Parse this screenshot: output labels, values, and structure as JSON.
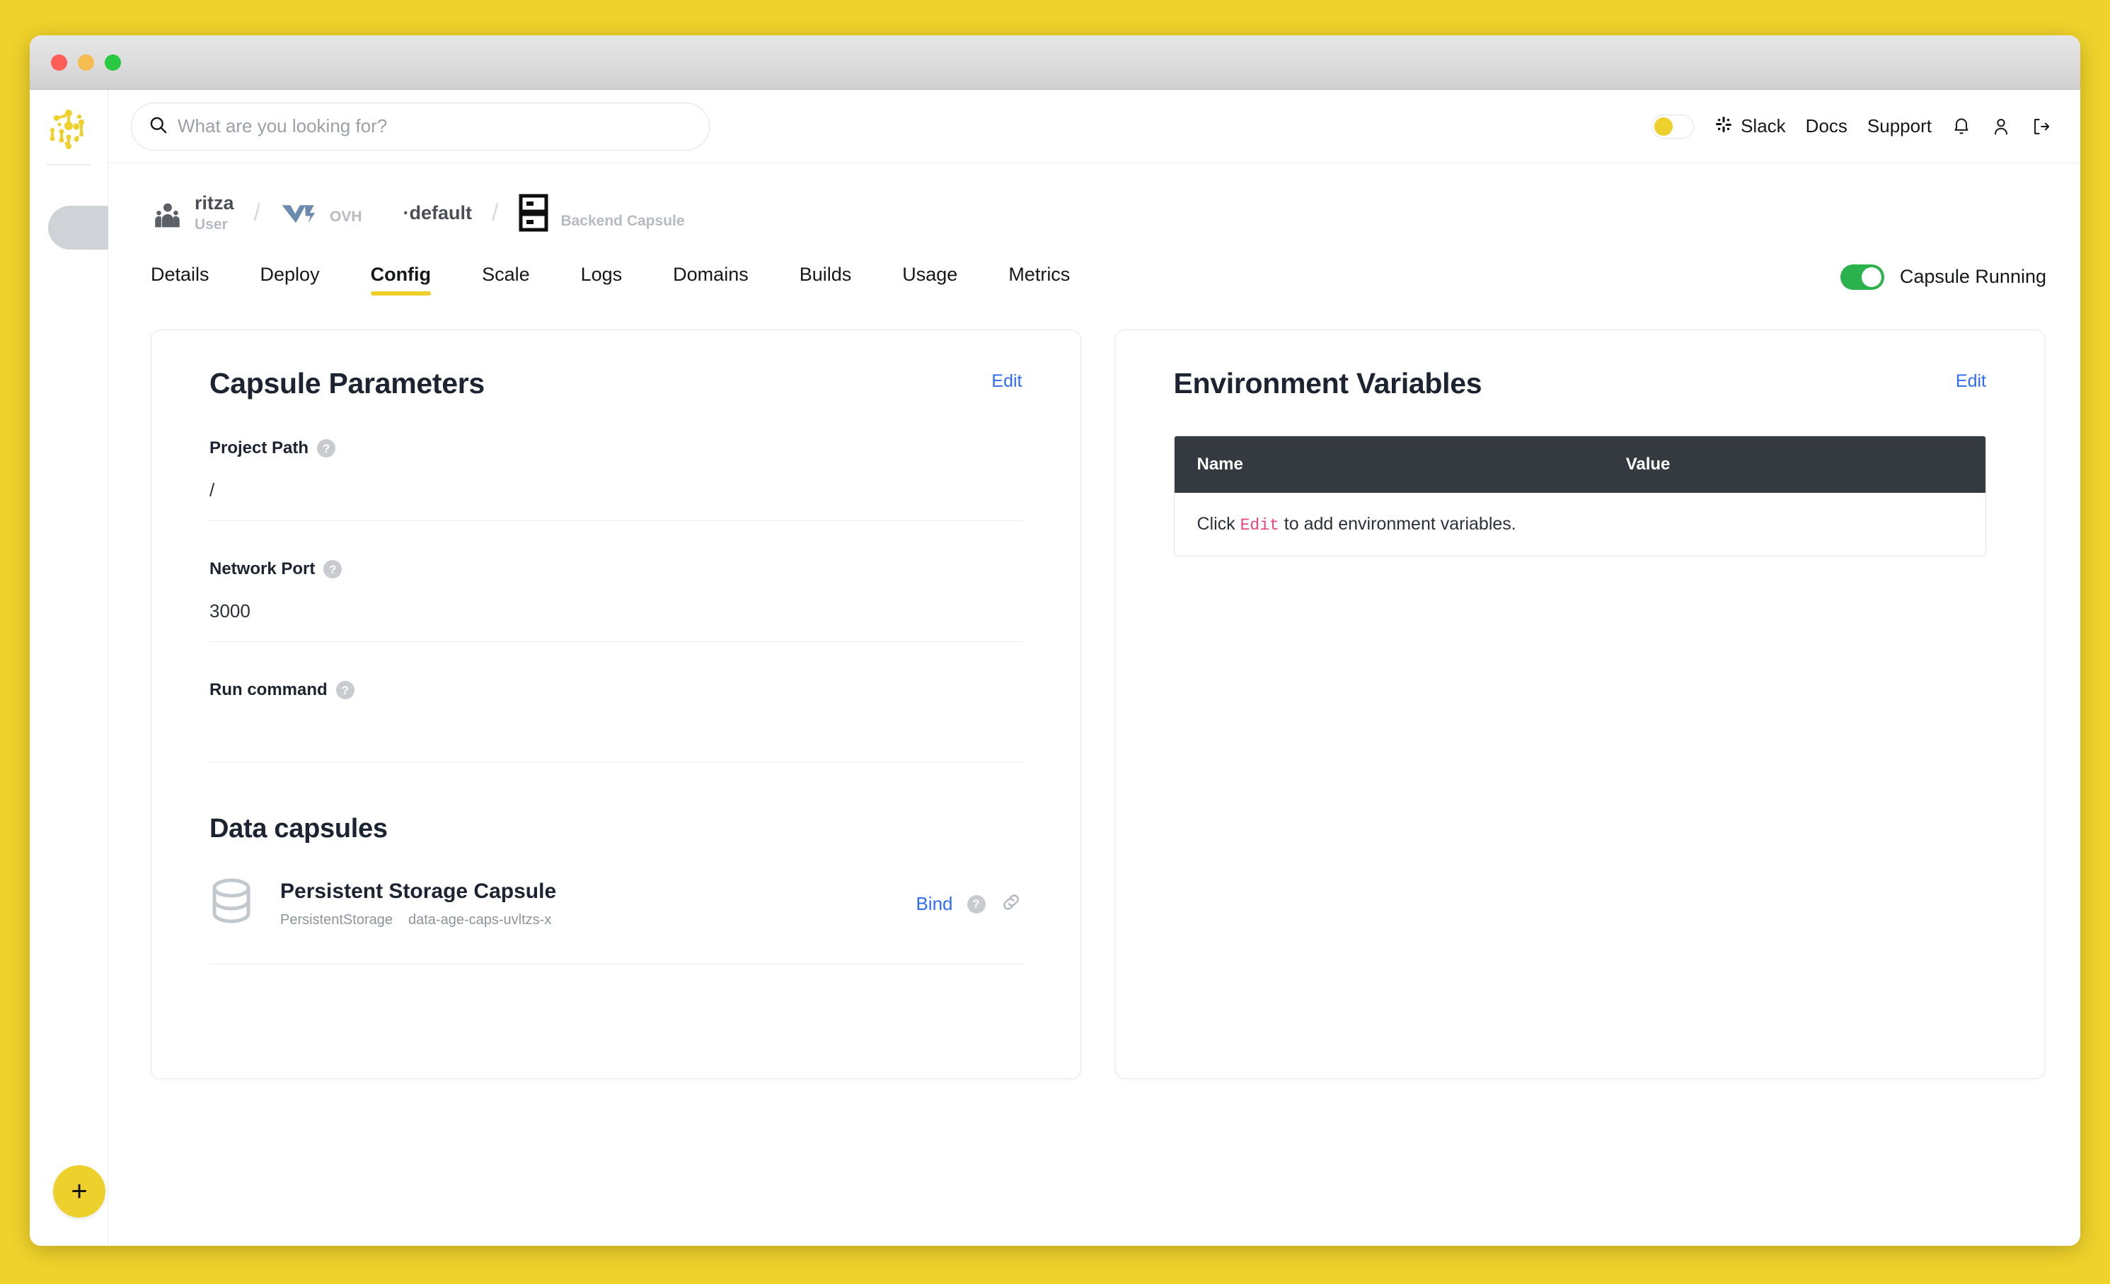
{
  "colors": {
    "page_background": "#EFD22B",
    "brand_yellow": "#EDD02B",
    "accent_link": "#2f6bff",
    "running_green": "#2bb24c",
    "table_header": "#343a40",
    "code_pink": "#e8467c"
  },
  "window": {
    "traffic_lights": [
      "close-red",
      "minimize-yellow",
      "zoom-green"
    ]
  },
  "rail": {
    "logo_name": "code-capsules-logo",
    "add_button_label": "+"
  },
  "topbar": {
    "search": {
      "placeholder": "What are you looking for?",
      "value": "",
      "icon": "search-icon"
    },
    "theme_toggle": {
      "state": "off",
      "icon": "theme-toggle"
    },
    "links": [
      {
        "label": "Slack",
        "icon": "slack-icon"
      },
      {
        "label": "Docs",
        "icon": null
      },
      {
        "label": "Support",
        "icon": null
      }
    ],
    "icons": [
      {
        "name": "notifications-bell-icon"
      },
      {
        "name": "user-account-icon"
      },
      {
        "name": "logout-icon"
      }
    ]
  },
  "breadcrumb": {
    "items": [
      {
        "title": "ritza",
        "subtitle": "User",
        "icon": "team-users-icon"
      },
      {
        "title": "",
        "subtitle": "OVH",
        "icon": "ovh-logo-icon"
      },
      {
        "title": "·default",
        "subtitle": "",
        "icon": null
      },
      {
        "title": "",
        "subtitle": "Backend Capsule",
        "icon": "capsule-server-icon"
      }
    ],
    "separator": "/"
  },
  "tabs": [
    {
      "label": "Details",
      "active": false
    },
    {
      "label": "Deploy",
      "active": false
    },
    {
      "label": "Config",
      "active": true
    },
    {
      "label": "Scale",
      "active": false
    },
    {
      "label": "Logs",
      "active": false
    },
    {
      "label": "Domains",
      "active": false
    },
    {
      "label": "Builds",
      "active": false
    },
    {
      "label": "Usage",
      "active": false
    },
    {
      "label": "Metrics",
      "active": false
    }
  ],
  "status": {
    "toggle_state": "on",
    "label": "Capsule Running"
  },
  "capsule_parameters": {
    "title": "Capsule Parameters",
    "edit_label": "Edit",
    "fields": [
      {
        "label": "Project Path",
        "value": "/",
        "help": "?"
      },
      {
        "label": "Network Port",
        "value": "3000",
        "help": "?"
      },
      {
        "label": "Run command",
        "value": "",
        "help": "?"
      }
    ],
    "data_capsules": {
      "title": "Data capsules",
      "items": [
        {
          "name": "Persistent Storage Capsule",
          "type": "PersistentStorage",
          "id": "data-age-caps-uvltzs-x",
          "icon": "database-storage-icon",
          "bind_label": "Bind",
          "help": "?",
          "link_icon": "chain-link-icon"
        }
      ]
    }
  },
  "environment_variables": {
    "title": "Environment Variables",
    "edit_label": "Edit",
    "columns": [
      "Name",
      "Value"
    ],
    "empty_prefix": "Click ",
    "empty_code": "Edit",
    "empty_suffix": " to add environment variables.",
    "rows": []
  }
}
